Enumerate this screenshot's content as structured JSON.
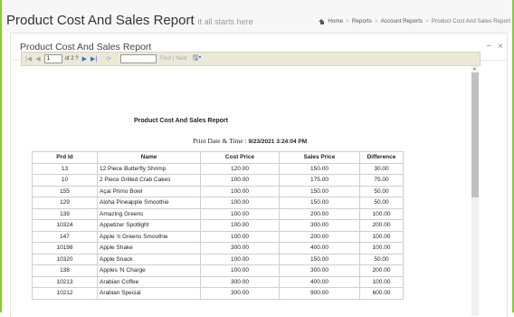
{
  "header": {
    "title": "Product Cost And Sales Report",
    "subtitle": "it all starts here",
    "breadcrumbs": [
      "Home",
      "Reports",
      "Account Reports",
      "Product Cost And Sales Report"
    ]
  },
  "panel": {
    "title": "Product Cost And Sales Report",
    "minimize": "−",
    "close": "×"
  },
  "toolbar": {
    "first": "|◀",
    "prev": "◀",
    "page_value": "1",
    "of_pages": "of 2 ?",
    "next": "▶",
    "last": "▶|",
    "refresh": "⟳",
    "find_value": "",
    "find_label": "Find",
    "find_sep": "|",
    "next_label": "Next",
    "export": "🖫▾"
  },
  "report": {
    "title": "Product Cost And Sales Report",
    "print_label": "Print Date & Time : ",
    "print_value": "9/23/2021 3:24:04 PM",
    "columns": [
      "Prd Id",
      "Name",
      "Cost Price",
      "Sales Price",
      "Difference"
    ],
    "rows": [
      [
        "13",
        "12 Piece Butterfly Shrimp",
        "120.00",
        "150.00",
        "30.00"
      ],
      [
        "10",
        "2 Piece Grilled Crab Cakes",
        "100.00",
        "175.00",
        "75.00"
      ],
      [
        "155",
        "Açai Primo Bowl",
        "100.00",
        "150.00",
        "50.00"
      ],
      [
        "129",
        "Aloha Pineapple Smoothie",
        "100.00",
        "150.00",
        "50.00"
      ],
      [
        "139",
        "Amazing Greens",
        "100.00",
        "200.00",
        "100.00"
      ],
      [
        "10324",
        "Appetizer Spotlight",
        "100.00",
        "300.00",
        "200.00"
      ],
      [
        "147",
        "Apple 'n Greens Smoothie",
        "100.00",
        "200.00",
        "100.00"
      ],
      [
        "10198",
        "Apple Shake",
        "300.00",
        "400.00",
        "100.00"
      ],
      [
        "10320",
        "Apple Snack",
        "100.00",
        "150.00",
        "50.00"
      ],
      [
        "138",
        "Apples 'N Charge",
        "100.00",
        "300.00",
        "200.00"
      ],
      [
        "10213",
        "Arabian Coffee",
        "300.00",
        "400.00",
        "100.00"
      ],
      [
        "10212",
        "Arabian Special",
        "300.00",
        "900.00",
        "600.00"
      ]
    ]
  },
  "colors": {
    "accent_border": "#8dc63f",
    "toolbar_bg": "#ece9d8",
    "nav_blue": "#3b6fd1"
  }
}
